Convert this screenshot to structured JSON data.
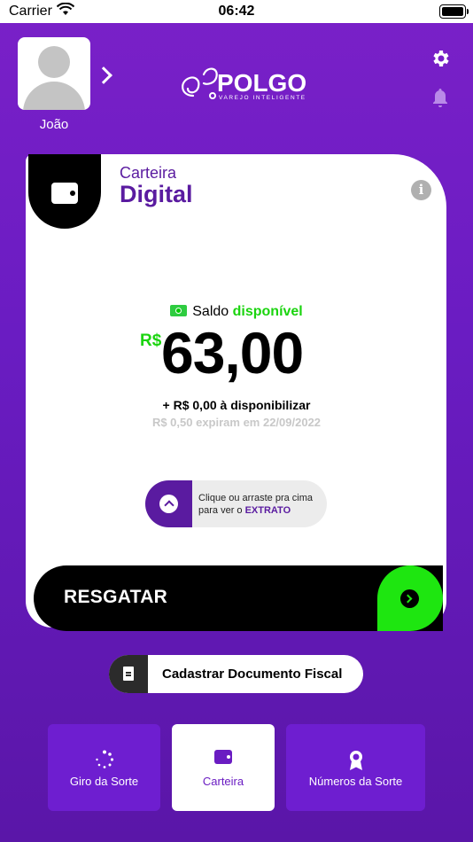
{
  "status_bar": {
    "carrier": "Carrier",
    "time": "06:42"
  },
  "header": {
    "username": "João",
    "logo_text": "POLGO",
    "logo_tagline": "VAREJO INTELIGENTE",
    "icons": [
      "avatar",
      "chevron-right-icon",
      "gear-icon",
      "bell-icon"
    ]
  },
  "wallet": {
    "title_small": "Carteira",
    "title_big": "Digital",
    "saldo_label": "Saldo",
    "saldo_status": "disponível",
    "currency": "R$",
    "amount": "63,00",
    "pending": "+ R$ 0,00 à disponibilizar",
    "expire": "R$ 0,50 expiram em 22/09/2022",
    "extrato_hint_prefix": "Clique ou arraste pra cima para ver o",
    "extrato_hint_strong": "EXTRATO"
  },
  "actions": {
    "resgatar_label": "RESGATAR",
    "fiscal_label": "Cadastrar Documento Fiscal"
  },
  "bottom_nav": {
    "items": [
      {
        "label": "Giro da Sorte",
        "icon": "spinner-icon",
        "active": false
      },
      {
        "label": "Carteira",
        "icon": "wallet-icon",
        "active": true
      },
      {
        "label": "Números da Sorte",
        "icon": "award-icon",
        "active": false
      }
    ]
  },
  "colors": {
    "brand_purple": "#6a1cc2",
    "accent_green": "#1ee610",
    "text_purple": "#5a1ba0"
  }
}
